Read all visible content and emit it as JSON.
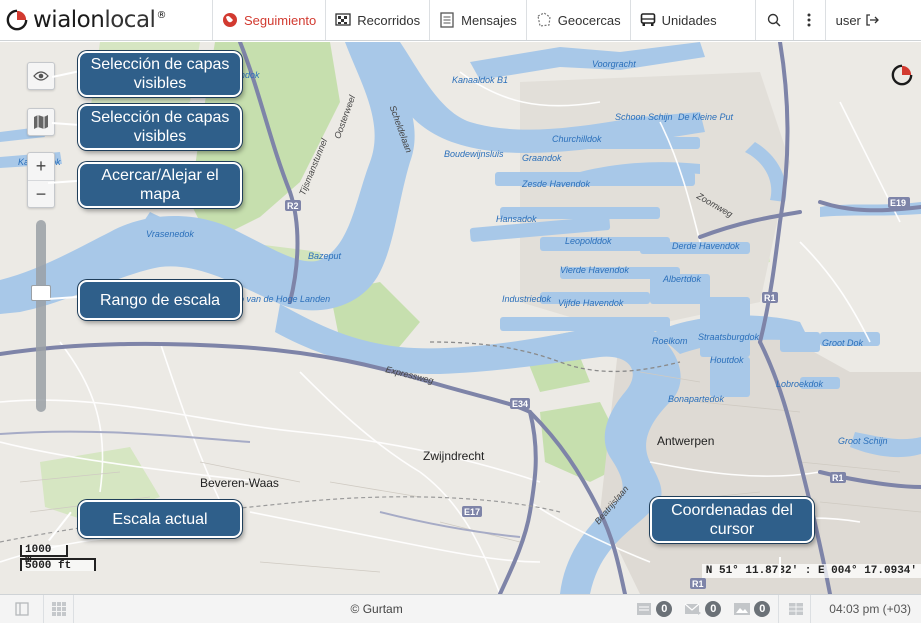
{
  "header": {
    "brand": {
      "name_part1": "wialon",
      "name_part2": "local",
      "superscript": "®"
    },
    "nav": [
      {
        "id": "tracking",
        "label": "Seguimiento",
        "icon": "globe-icon",
        "active": true
      },
      {
        "id": "tracks",
        "label": "Recorridos",
        "icon": "checkered-flag-icon",
        "active": false
      },
      {
        "id": "messages",
        "label": "Mensajes",
        "icon": "document-icon",
        "active": false
      },
      {
        "id": "geofences",
        "label": "Geocercas",
        "icon": "geofence-icon",
        "active": false
      },
      {
        "id": "units",
        "label": "Unidades",
        "icon": "car-icon",
        "active": false
      }
    ],
    "search_icon": "search-icon",
    "menu_icon": "vertical-dots-icon",
    "user": {
      "label": "user",
      "icon": "logout-icon"
    }
  },
  "map": {
    "water_labels": [
      "Kanaaldok B1",
      "Voorgracht",
      "Schoon",
      "Schijn",
      "De Kleine Put",
      "Churchilldok",
      "Boudewijnsluis",
      "Graandok",
      "Zesde Havendok",
      "Hansadok",
      "Leopolddok",
      "Derde Havendok",
      "Vierde Havendok",
      "Albertdok",
      "Industriedok",
      "Vijfde Havendok",
      "Roelkom",
      "Straatsburgdok",
      "Houtdok",
      "Groot Dok",
      "Lobroekdok",
      "Bonapartedok",
      "Groot Schijn",
      "Vrasenedok",
      "Bazeput",
      "Po van de Hoge Landen",
      "Kanaaldok",
      "ndok"
    ],
    "place_labels": [
      "Antwerpen",
      "Zwijndrecht",
      "Beveren-Waas"
    ],
    "road_labels": [
      "Expressweg",
      "E34",
      "E17",
      "E19",
      "R1",
      "R2",
      "Beatrijslaan",
      "Zoomweg",
      "Oosterweel",
      "Scheldelaan",
      "Tijsmanstunnel"
    ],
    "scale": {
      "metric": "1000 m",
      "imperial": "5000 ft"
    },
    "coordinates": "N 51° 11.8732' : E 004° 17.0934'",
    "controls": {
      "layers_icon": "eye-icon",
      "map_source_icon": "map-icon",
      "zoom_in": "+",
      "zoom_out": "−",
      "zoom_level_fraction": 0.37
    }
  },
  "callouts": [
    {
      "id": "visible-layers-1",
      "text": "Selección de capas visibles"
    },
    {
      "id": "visible-layers-2",
      "text": "Selección de capas visibles"
    },
    {
      "id": "zoom",
      "text": "Acercar/Alejar el mapa"
    },
    {
      "id": "scale-range",
      "text": "Rango de escala"
    },
    {
      "id": "current-scale",
      "text": "Escala actual"
    },
    {
      "id": "cursor-coords",
      "text": "Coordenadas del cursor"
    }
  ],
  "footer": {
    "copyright": "© Gurtam",
    "counters": [
      {
        "icon": "report-icon",
        "count": "0"
      },
      {
        "icon": "mail-icon",
        "count": "0"
      },
      {
        "icon": "image-icon",
        "count": "0"
      }
    ],
    "time": "04:03 pm (+03)"
  },
  "colors": {
    "accent": "#d23a30",
    "water": "#a8c8e8",
    "park": "#c6dfae",
    "callout": "#2f5f8a",
    "highway": "#7e84a8"
  }
}
